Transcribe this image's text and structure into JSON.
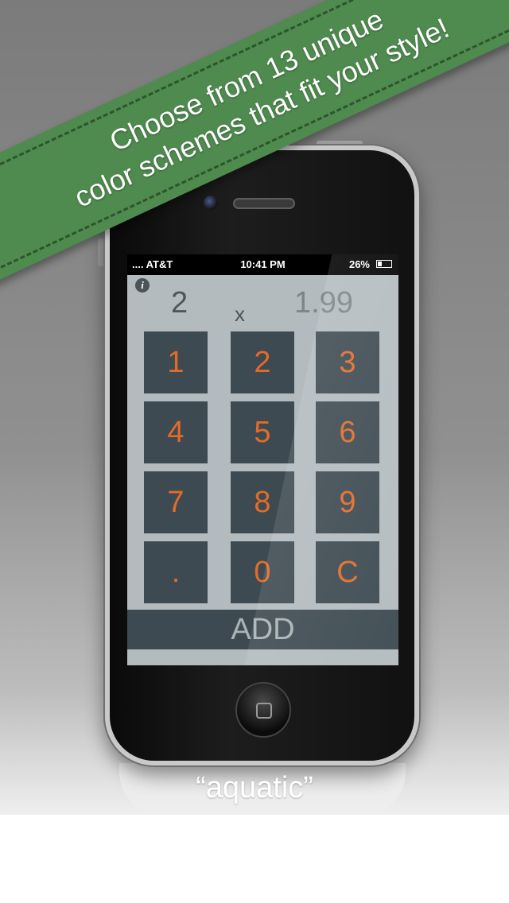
{
  "banner": {
    "line1": "Choose from 13 unique",
    "line2": "color schemes that fit your style!",
    "color": "#4f8a4f"
  },
  "status_bar": {
    "carrier": ".... AT&T",
    "time": "10:41 PM",
    "battery": "26%"
  },
  "calculator": {
    "info_label": "i",
    "quantity": "2",
    "operator": "x",
    "price": "1.99",
    "keys": [
      "1",
      "2",
      "3",
      "4",
      "5",
      "6",
      "7",
      "8",
      "9",
      ".",
      "0",
      "C"
    ],
    "add_label": "ADD",
    "key_color": "#3d4a51",
    "digit_color": "#e36b2a",
    "screen_color": "#b3bbbf"
  },
  "caption": "“aquatic”"
}
